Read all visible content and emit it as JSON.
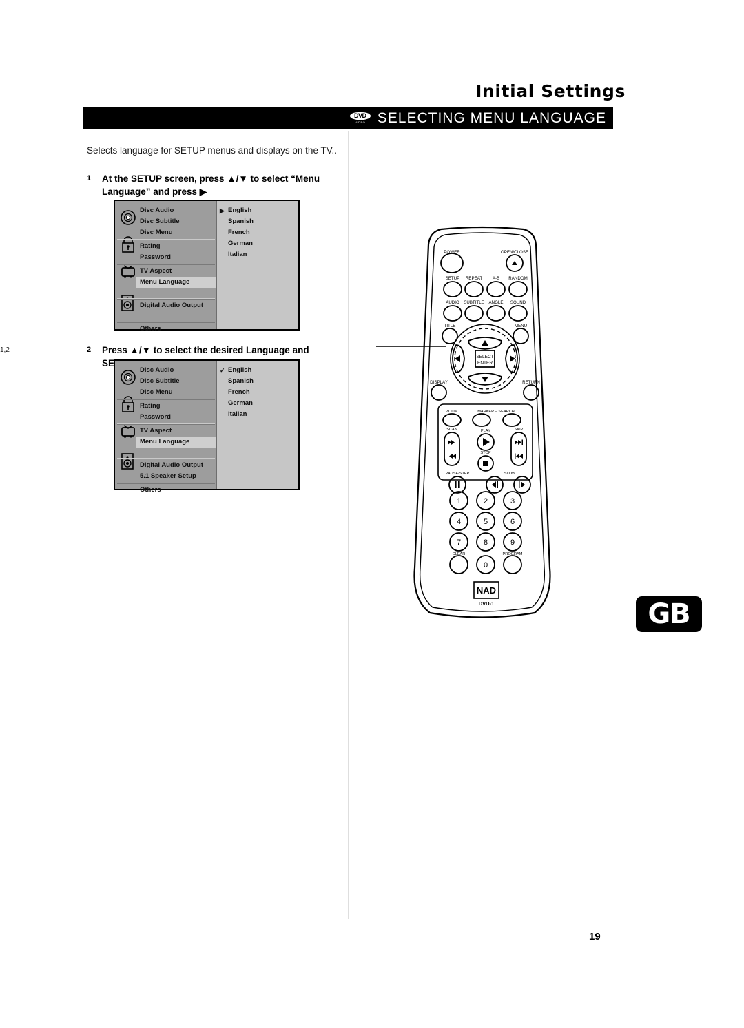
{
  "header": {
    "title": "Initial Settings",
    "section_title": "SELECTING MENU LANGUAGE",
    "dvd_logo_top": "DVD",
    "dvd_logo_bottom": "VIDEO"
  },
  "intro_text": "Selects language for SETUP menus and displays on the TV..",
  "steps": [
    {
      "number": "1",
      "text": "At the SETUP screen, press ▲/▼ to select “Menu Language” and press ▶"
    },
    {
      "number": "2",
      "text": "Press ▲/▼ to select the desired Language and SELECT/ENTER"
    }
  ],
  "setup_screens": [
    {
      "id": "screen-1",
      "menu_items": [
        "Disc Audio",
        "Disc Subtitle",
        "Disc Menu",
        "Rating",
        "Password",
        "TV Aspect",
        "Menu Language",
        "Digital Audio Output",
        "Others"
      ],
      "selected_item": "Menu Language",
      "languages": [
        "English",
        "Spanish",
        "French",
        "German",
        "Italian"
      ],
      "language_marker": "▶",
      "marked_language": "English"
    },
    {
      "id": "screen-2",
      "menu_items": [
        "Disc Audio",
        "Disc Subtitle",
        "Disc Menu",
        "Rating",
        "Password",
        "TV Aspect",
        "Menu Language",
        "Digital Audio Output",
        "5.1 Speaker Setup",
        "Others"
      ],
      "selected_item": "Menu Language",
      "languages": [
        "English",
        "Spanish",
        "French",
        "German",
        "Italian"
      ],
      "language_marker": "✓",
      "marked_language": "English"
    }
  ],
  "remote": {
    "callout": "1,2",
    "brand": "NAD",
    "model": "DVD-1",
    "buttons": {
      "power": "POWER",
      "open_close": "OPEN/CLOSE",
      "setup": "SETUP",
      "repeat": "REPEAT",
      "ab": "A-B",
      "random": "RANDOM",
      "audio": "AUDIO",
      "subtitle": "SUBTITLE",
      "angle": "ANGLE",
      "sound": "SOUND",
      "title": "TITLE",
      "menu": "MENU",
      "select_enter_line1": "SELECT",
      "select_enter_line2": "ENTER",
      "display": "DISPLAY",
      "return": "RETURN",
      "zoom": "ZOOM",
      "marker_search": "MARKER – SEARCH",
      "scan": "SCAN",
      "play": "PLAY",
      "skip": "SKIP",
      "stop": "STOP",
      "pause_step": "PAUSE/STEP",
      "slow": "SLOW",
      "clear": "CLEAR",
      "program": "PROGRAM"
    },
    "keypad": [
      "1",
      "2",
      "3",
      "4",
      "5",
      "6",
      "7",
      "8",
      "9",
      "0"
    ]
  },
  "region_badge": "GB",
  "page_number": "19",
  "colors": {
    "header_bar": "#000000",
    "menu_left_panel": "#9d9d9d",
    "menu_right_panel": "#c6c6c6",
    "menu_selected": "#cfcfcf",
    "divider": "#dedede"
  }
}
